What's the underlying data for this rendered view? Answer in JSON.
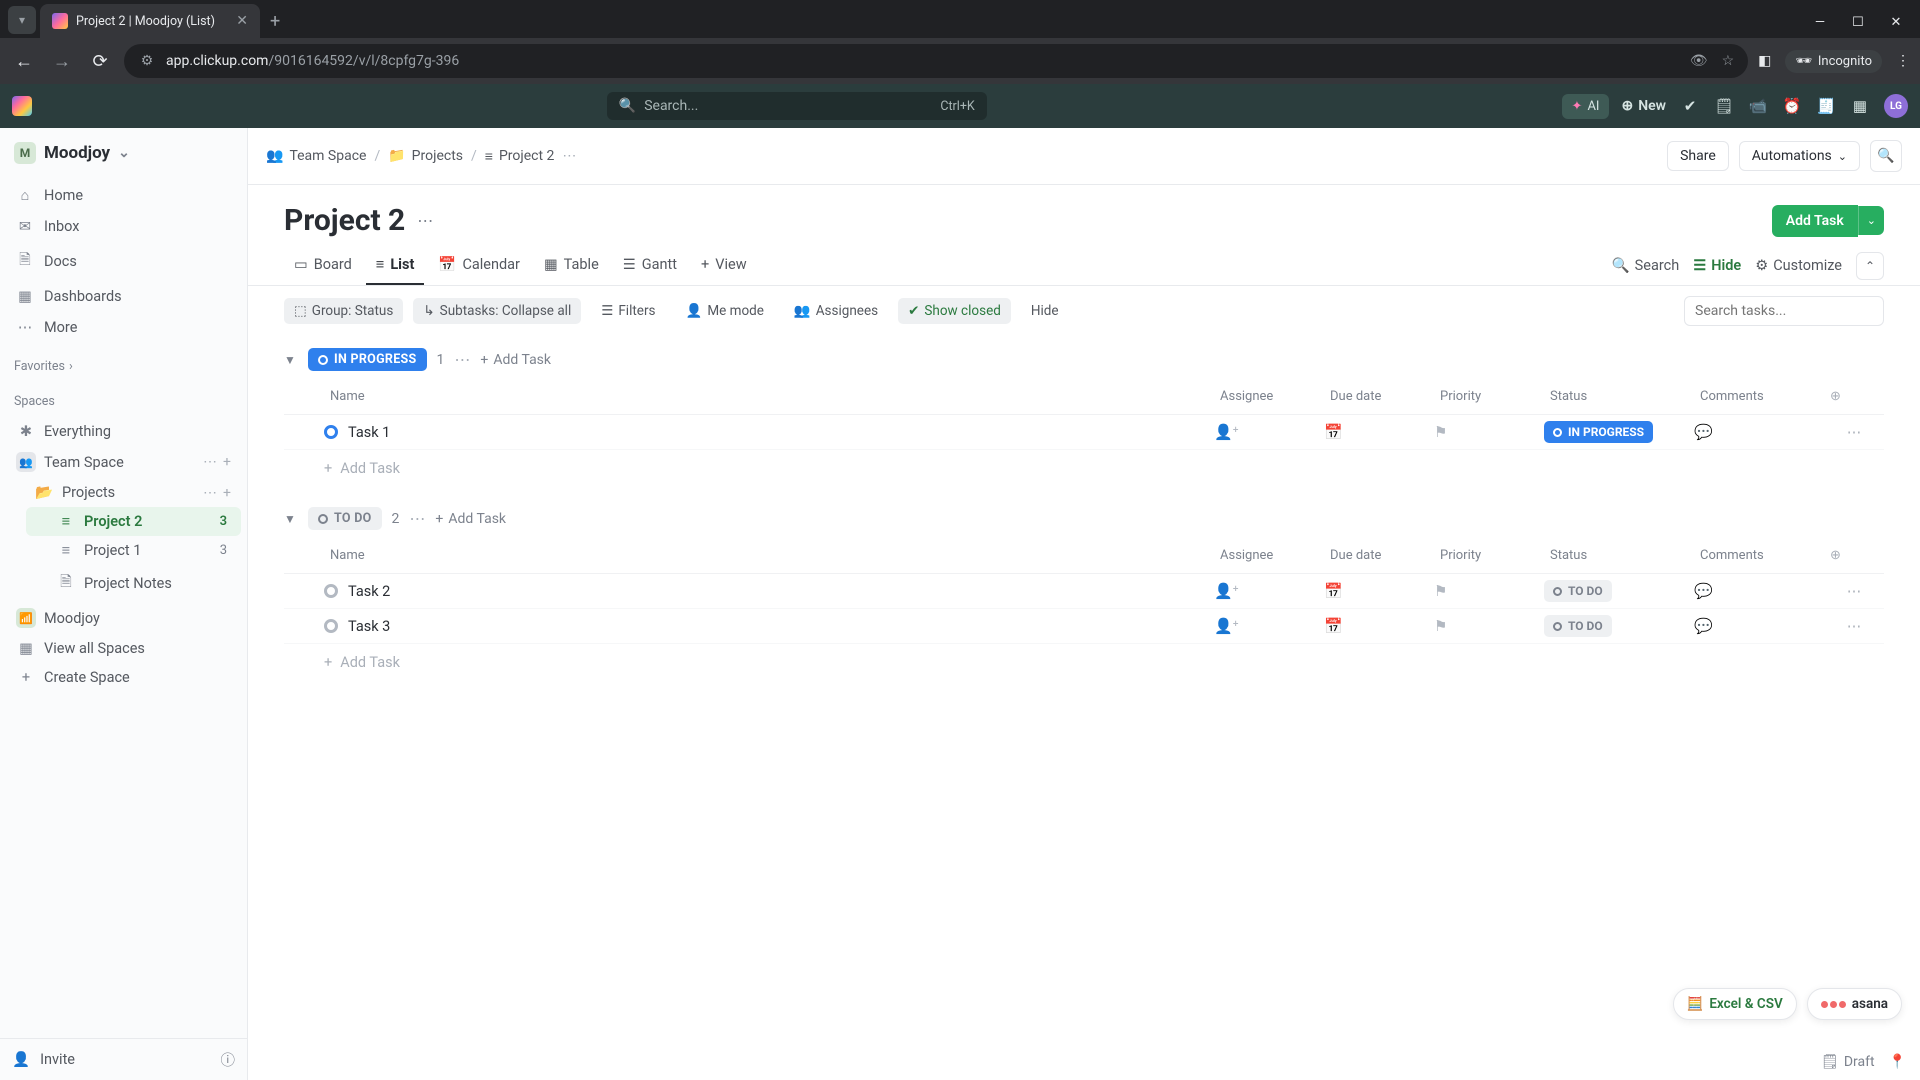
{
  "browser": {
    "tab_title": "Project 2 | Moodjoy (List)",
    "url_domain": "app.clickup.com",
    "url_path": "/9016164592/v/l/8cpfg7g-396",
    "incognito_label": "Incognito"
  },
  "topbar": {
    "search_placeholder": "Search...",
    "search_shortcut": "Ctrl+K",
    "ai_label": "AI",
    "new_label": "New",
    "avatar_initials": "LG"
  },
  "sidebar": {
    "workspace": "Moodjoy",
    "nav": {
      "home": "Home",
      "inbox": "Inbox",
      "docs": "Docs",
      "dashboards": "Dashboards",
      "more": "More"
    },
    "favorites_label": "Favorites",
    "spaces_label": "Spaces",
    "everything": "Everything",
    "team_space": "Team Space",
    "projects_folder": "Projects",
    "project2": {
      "name": "Project 2",
      "count": "3"
    },
    "project1": {
      "name": "Project 1",
      "count": "3"
    },
    "project_notes": "Project Notes",
    "moodjoy_space": "Moodjoy",
    "view_all": "View all Spaces",
    "create_space": "Create Space",
    "invite": "Invite"
  },
  "breadcrumb": {
    "team_space": "Team Space",
    "projects": "Projects",
    "project2": "Project 2",
    "share": "Share",
    "automations": "Automations"
  },
  "page": {
    "title": "Project 2",
    "add_task": "Add Task"
  },
  "views": {
    "board": "Board",
    "list": "List",
    "calendar": "Calendar",
    "table": "Table",
    "gantt": "Gantt",
    "view": "View",
    "search": "Search",
    "hide": "Hide",
    "customize": "Customize"
  },
  "filters": {
    "group_status": "Group: Status",
    "subtasks": "Subtasks: Collapse all",
    "filters": "Filters",
    "me_mode": "Me mode",
    "assignees": "Assignees",
    "show_closed": "Show closed",
    "hide": "Hide",
    "search_placeholder": "Search tasks..."
  },
  "columns": {
    "name": "Name",
    "assignee": "Assignee",
    "due": "Due date",
    "priority": "Priority",
    "status": "Status",
    "comments": "Comments"
  },
  "groups": {
    "in_progress": {
      "label": "IN PROGRESS",
      "count": "1",
      "add": "Add Task",
      "rows": [
        {
          "name": "Task 1",
          "status": "IN PROGRESS"
        }
      ],
      "add_row": "Add Task"
    },
    "to_do": {
      "label": "TO DO",
      "count": "2",
      "add": "Add Task",
      "rows": [
        {
          "name": "Task 2",
          "status": "TO DO"
        },
        {
          "name": "Task 3",
          "status": "TO DO"
        }
      ],
      "add_row": "Add Task"
    }
  },
  "float": {
    "excel": "Excel & CSV",
    "asana": "asana"
  },
  "footer": {
    "draft": "Draft"
  }
}
